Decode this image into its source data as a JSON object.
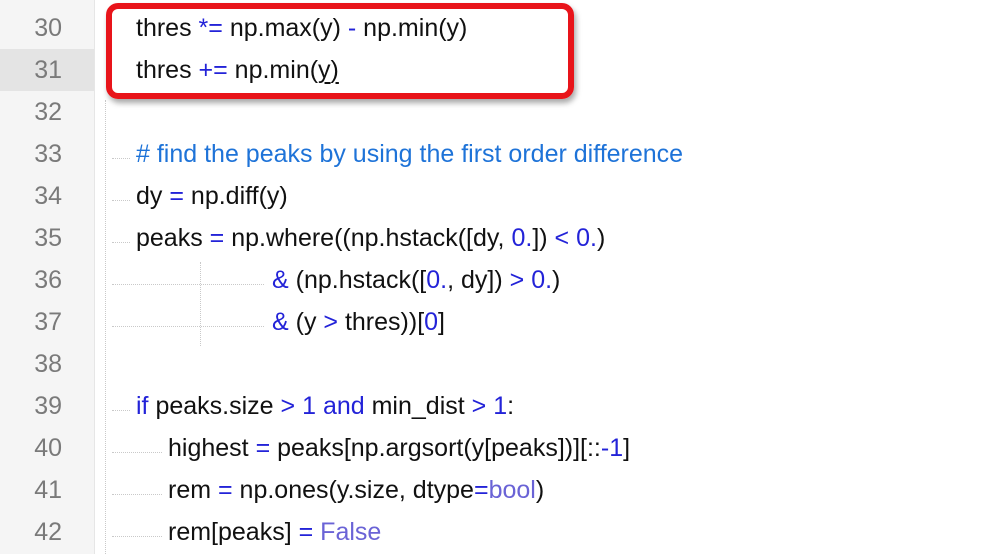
{
  "editor": {
    "lines": [
      {
        "number": "30",
        "parts": [
          "thres ",
          "*=",
          " np.max(y) ",
          "-",
          " np.min(y)"
        ]
      },
      {
        "number": "31",
        "parts": [
          "thres ",
          "+=",
          " np.min(",
          "y",
          ")"
        ]
      },
      {
        "number": "32",
        "parts": []
      },
      {
        "number": "33",
        "parts": [
          "# find the peaks by using the first order difference"
        ]
      },
      {
        "number": "34",
        "parts": [
          "dy ",
          "=",
          " np.diff(y)"
        ]
      },
      {
        "number": "35",
        "parts": [
          "peaks ",
          "=",
          " np.where((np.hstack([dy, ",
          "0.",
          "]) ",
          "<",
          " ",
          "0.",
          ")"
        ]
      },
      {
        "number": "36",
        "parts": [
          "&",
          " (np.hstack([",
          "0.",
          ", dy]) ",
          ">",
          " ",
          "0.",
          ")"
        ]
      },
      {
        "number": "37",
        "parts": [
          "&",
          " (y ",
          ">",
          " thres))[",
          "0",
          "]"
        ]
      },
      {
        "number": "38",
        "parts": []
      },
      {
        "number": "39",
        "parts": [
          "if",
          " peaks.size ",
          ">",
          " ",
          "1",
          " ",
          "and",
          " min_dist ",
          ">",
          " ",
          "1",
          ":"
        ]
      },
      {
        "number": "40",
        "parts": [
          "highest ",
          "=",
          " peaks[np.argsort(y[peaks])][::",
          "-1",
          "]"
        ]
      },
      {
        "number": "41",
        "parts": [
          "rem ",
          "=",
          " np.ones(y.size, dtype",
          "=",
          "bool",
          ")"
        ]
      },
      {
        "number": "42",
        "parts": [
          "rem[peaks] ",
          "=",
          " ",
          "False"
        ]
      }
    ]
  },
  "annotation": {
    "color": "#e8141a",
    "highlighted_lines": [
      "30",
      "31"
    ]
  }
}
